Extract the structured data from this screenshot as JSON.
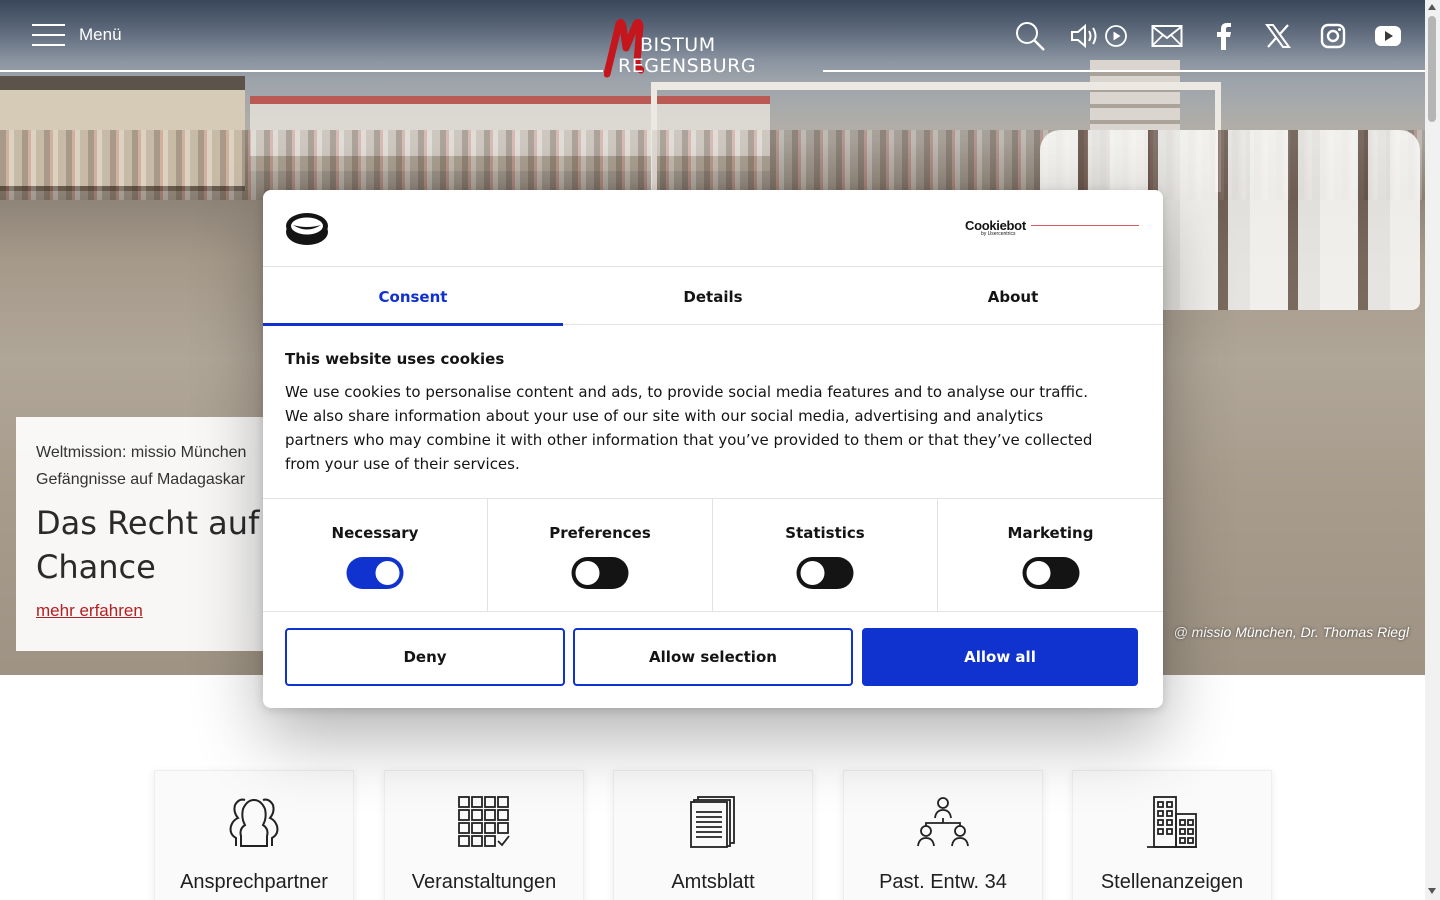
{
  "header": {
    "menu_label": "Menü",
    "logo_line1": "BISTUM",
    "logo_line2": "REGENSBURG",
    "icons": [
      "search-icon",
      "speaker-icon",
      "play-icon",
      "mail-icon",
      "facebook-icon",
      "x-icon",
      "instagram-icon",
      "youtube-icon"
    ]
  },
  "hero": {
    "kicker": "Weltmission: missio München Gefängnisse auf Madagaskar",
    "title": "Das Recht auf Chance",
    "link": "mehr erfahren",
    "credit": "@ missio München, Dr. Thomas Riegl"
  },
  "quick_links": [
    {
      "label": "Ansprechpartner",
      "icon": "people-icon"
    },
    {
      "label": "Veranstaltungen",
      "icon": "calendar-icon"
    },
    {
      "label": "Amtsblatt",
      "icon": "document-icon"
    },
    {
      "label": "Past. Entw. 34",
      "icon": "network-icon"
    },
    {
      "label": "Stellenanzeigen",
      "icon": "building-icon"
    }
  ],
  "cookie_dialog": {
    "brand": "Cookiebot",
    "brand_sub": "by Usercentrics",
    "tabs": [
      "Consent",
      "Details",
      "About"
    ],
    "active_tab": "Consent",
    "title": "This website uses cookies",
    "text": "We use cookies to personalise content and ads, to provide social media features and to analyse our traffic. We also share information about your use of our site with our social media, advertising and analytics partners who may combine it with other information that you’ve provided to them or that they’ve collected from your use of their services.",
    "categories": [
      {
        "label": "Necessary",
        "enabled": true
      },
      {
        "label": "Preferences",
        "enabled": false
      },
      {
        "label": "Statistics",
        "enabled": false
      },
      {
        "label": "Marketing",
        "enabled": false
      }
    ],
    "buttons": {
      "deny": "Deny",
      "allow_selection": "Allow selection",
      "allow_all": "Allow all"
    }
  },
  "colors": {
    "accent": "#1032cf",
    "brand_red": "#b51f22",
    "text": "#141414"
  }
}
